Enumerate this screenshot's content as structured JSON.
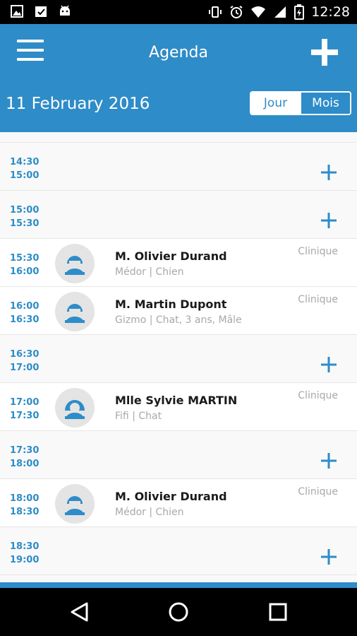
{
  "status_bar": {
    "time": "12:28",
    "left_icons": [
      "image-icon",
      "checklist-icon",
      "android-icon"
    ],
    "right_icons": [
      "vibrate-icon",
      "alarm-icon",
      "wifi-icon",
      "signal-icon",
      "battery-charging-icon"
    ]
  },
  "app_bar": {
    "title": "Agenda",
    "date": "11 February 2016",
    "toggle": {
      "day": "Jour",
      "month": "Mois",
      "selected": "Jour"
    },
    "color": "#2e8cc8"
  },
  "slots": [
    {
      "start": "14:30",
      "end": "15:00"
    },
    {
      "start": "15:00",
      "end": "15:30"
    },
    {
      "start": "15:30",
      "end": "16:00",
      "name": "M. Olivier Durand",
      "info": "Médor | Chien",
      "location": "Clinique",
      "avatar": "male-avatar-icon"
    },
    {
      "start": "16:00",
      "end": "16:30",
      "name": "M. Martin Dupont",
      "info": "Gizmo | Chat, 3 ans, Mâle",
      "location": "Clinique",
      "avatar": "male-avatar-icon"
    },
    {
      "start": "16:30",
      "end": "17:00"
    },
    {
      "start": "17:00",
      "end": "17:30",
      "name": "Mlle Sylvie MARTIN",
      "info": "Fifi | Chat",
      "location": "Clinique",
      "avatar": "female-avatar-icon"
    },
    {
      "start": "17:30",
      "end": "18:00"
    },
    {
      "start": "18:00",
      "end": "18:30",
      "name": "M. Olivier Durand",
      "info": "Médor | Chien",
      "location": "Clinique",
      "avatar": "male-avatar-icon"
    },
    {
      "start": "18:30",
      "end": "19:00"
    }
  ],
  "nav": [
    "back-icon",
    "home-icon",
    "recents-icon"
  ]
}
